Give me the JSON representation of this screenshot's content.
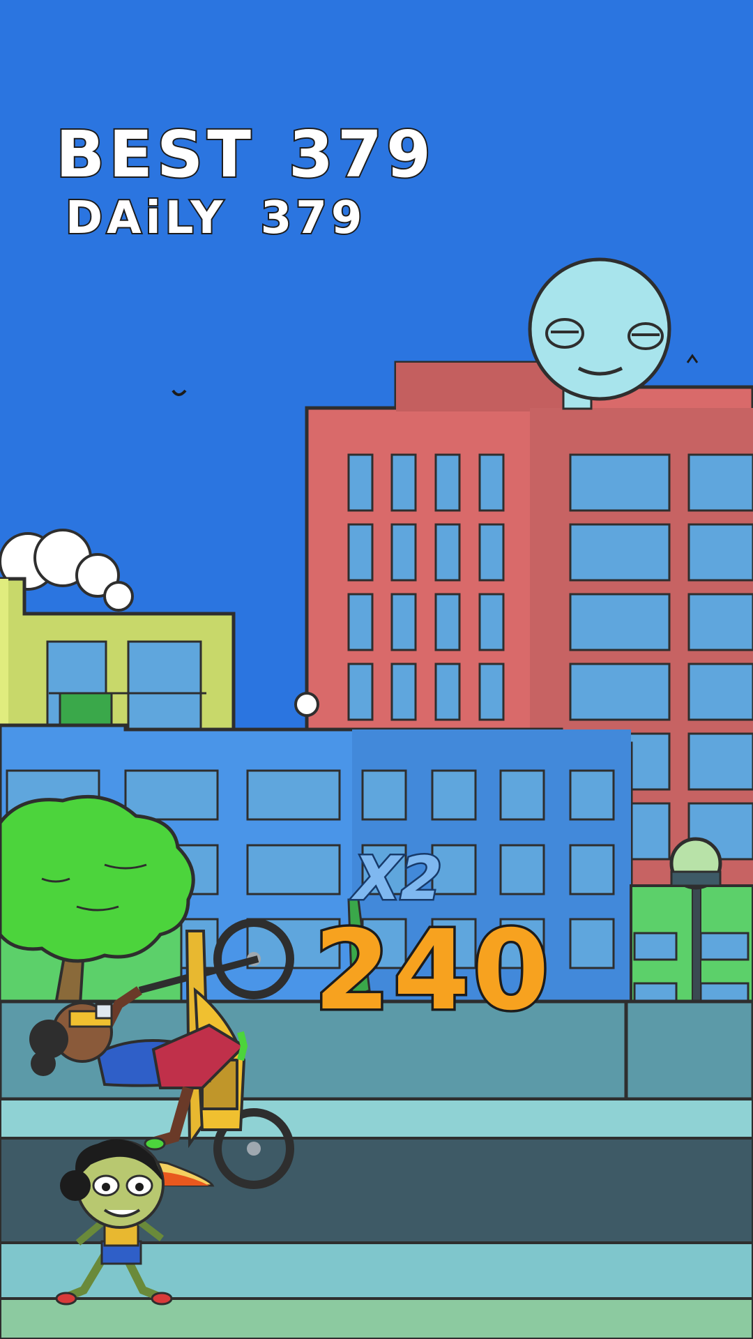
{
  "hud": {
    "best_label": "BEST",
    "best_value": "379",
    "daily_label": "DAiLY",
    "daily_value": "379"
  },
  "combo": {
    "multiplier": "X2",
    "score": "240"
  },
  "colors": {
    "sky": "#2b75e0",
    "red_building": "#d96a6a",
    "blue_building": "#4a95e8",
    "yellow_building": "#c8d86a",
    "moon": "#a8e4ec",
    "tree": "#4cd43c",
    "wall": "#5c9aa8",
    "road": "#3e5a66",
    "sidewalk": "#7fc6cc",
    "score": "#f7a21f"
  }
}
